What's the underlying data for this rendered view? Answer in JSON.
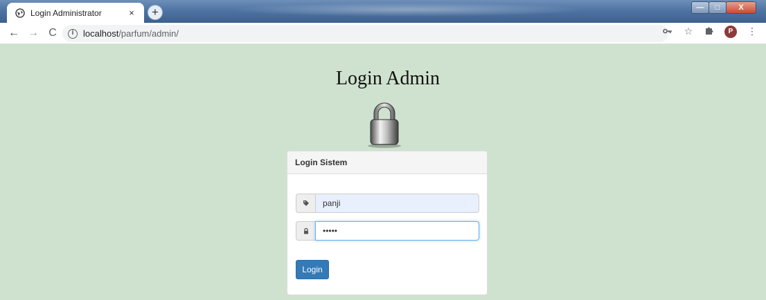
{
  "browser": {
    "tab_title": "Login Administrator",
    "tab_close": "×",
    "new_tab": "+",
    "url_host": "localhost",
    "url_path": "/parfum/admin/",
    "nav": {
      "back": "←",
      "forward": "→",
      "reload": "C"
    },
    "profile_initial": "P",
    "window_controls": {
      "minimize": "—",
      "maximize": "□",
      "close": "X"
    }
  },
  "page": {
    "title": "Login Admin",
    "panel_heading": "Login Sistem",
    "username_value": "panji",
    "password_value": "•••••",
    "login_label": "Login"
  },
  "icons": [
    "globe-icon",
    "info-icon",
    "key-icon",
    "star-icon",
    "puzzle-icon",
    "more-icon",
    "padlock-icon",
    "tag-icon",
    "lock-icon"
  ],
  "colors": {
    "page_bg": "#cfe2cf",
    "primary_button": "#337ab7",
    "autofill": "#e8f0fe"
  }
}
